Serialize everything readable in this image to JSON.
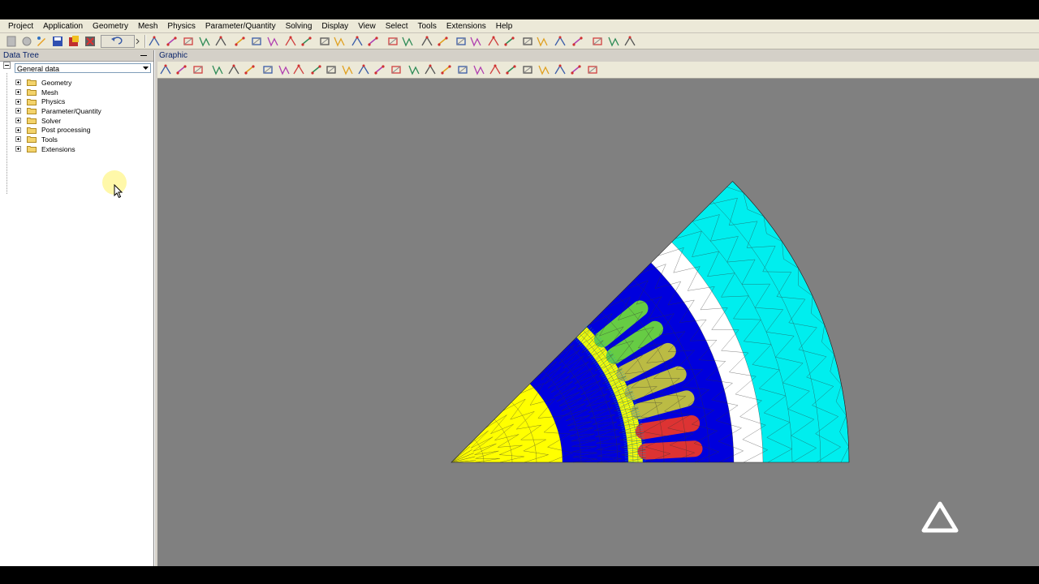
{
  "menubar": {
    "items": [
      "Project",
      "Application",
      "Geometry",
      "Mesh",
      "Physics",
      "Parameter/Quantity",
      "Solving",
      "Display",
      "View",
      "Select",
      "Tools",
      "Extensions",
      "Help"
    ]
  },
  "data_tree": {
    "title": "Data Tree",
    "dropdown_value": "General data",
    "items": [
      {
        "label": "Geometry"
      },
      {
        "label": "Mesh"
      },
      {
        "label": "Physics"
      },
      {
        "label": "Parameter/Quantity"
      },
      {
        "label": "Solver"
      },
      {
        "label": "Post processing"
      },
      {
        "label": "Tools"
      },
      {
        "label": "Extensions"
      }
    ]
  },
  "graphic": {
    "title": "Graphic",
    "mesh_colors": {
      "shaft": "#ffff00",
      "rotor": "#0000dd",
      "airgap": "#ffff00",
      "stator": "#0000dd",
      "coil_phase_a": "#66cc44",
      "coil_phase_b": "#bbbb44",
      "coil_phase_c": "#dd3333",
      "insulation": "#ffffff",
      "outer_air": "#00eeee"
    }
  },
  "logo_icon": "triangle-logo-icon"
}
